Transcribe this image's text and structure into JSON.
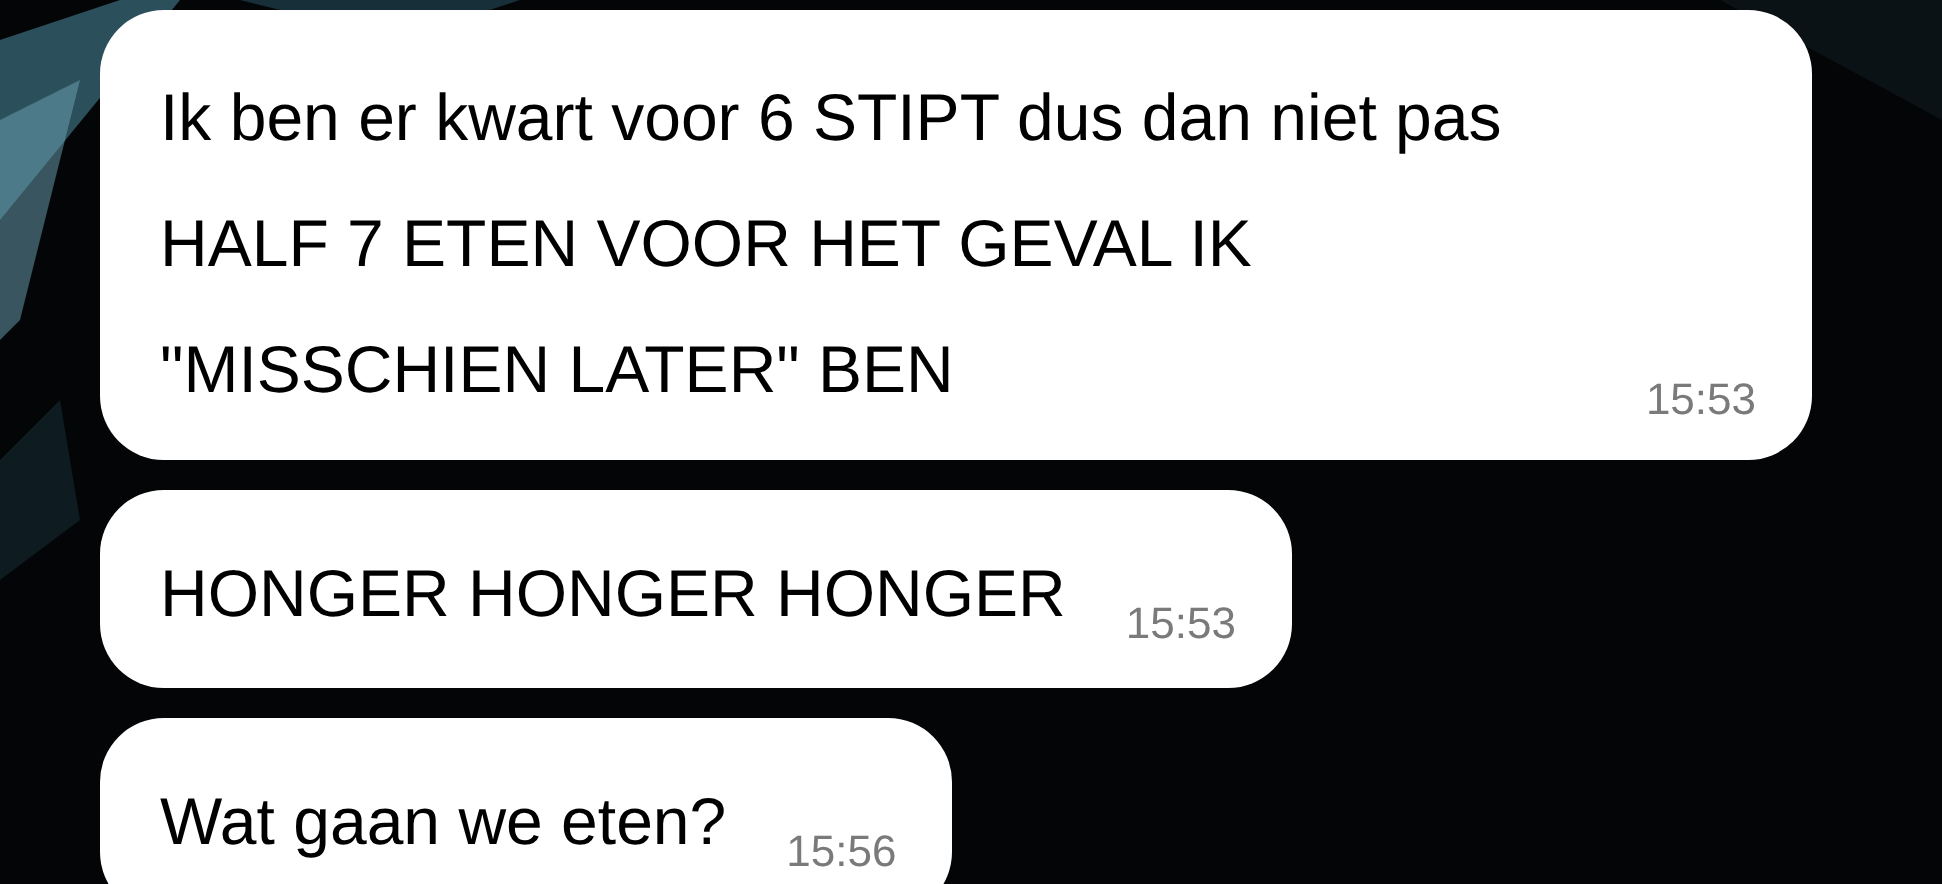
{
  "messages": [
    {
      "text": "Ik ben er kwart voor 6 STIPT dus dan niet pas HALF 7 ETEN VOOR HET GEVAL IK \"MISSCHIEN LATER\" BEN",
      "time": "15:53"
    },
    {
      "text": "HONGER HONGER HONGER",
      "time": "15:53"
    },
    {
      "text": "Wat gaan we eten?",
      "time": "15:56"
    }
  ]
}
